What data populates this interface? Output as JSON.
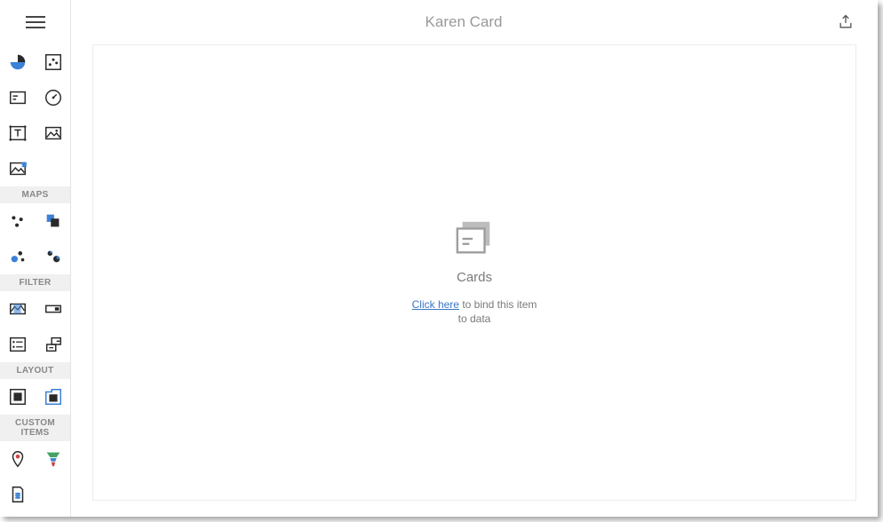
{
  "header": {
    "title": "Karen Card"
  },
  "empty_state": {
    "label": "Cards",
    "link_text": "Click here",
    "rest_text": " to bind this item to data"
  },
  "sections": {
    "common": "",
    "maps": "MAPS",
    "filter": "FILTER",
    "layout": "LAYOUT",
    "custom": "CUSTOM ITEMS"
  }
}
